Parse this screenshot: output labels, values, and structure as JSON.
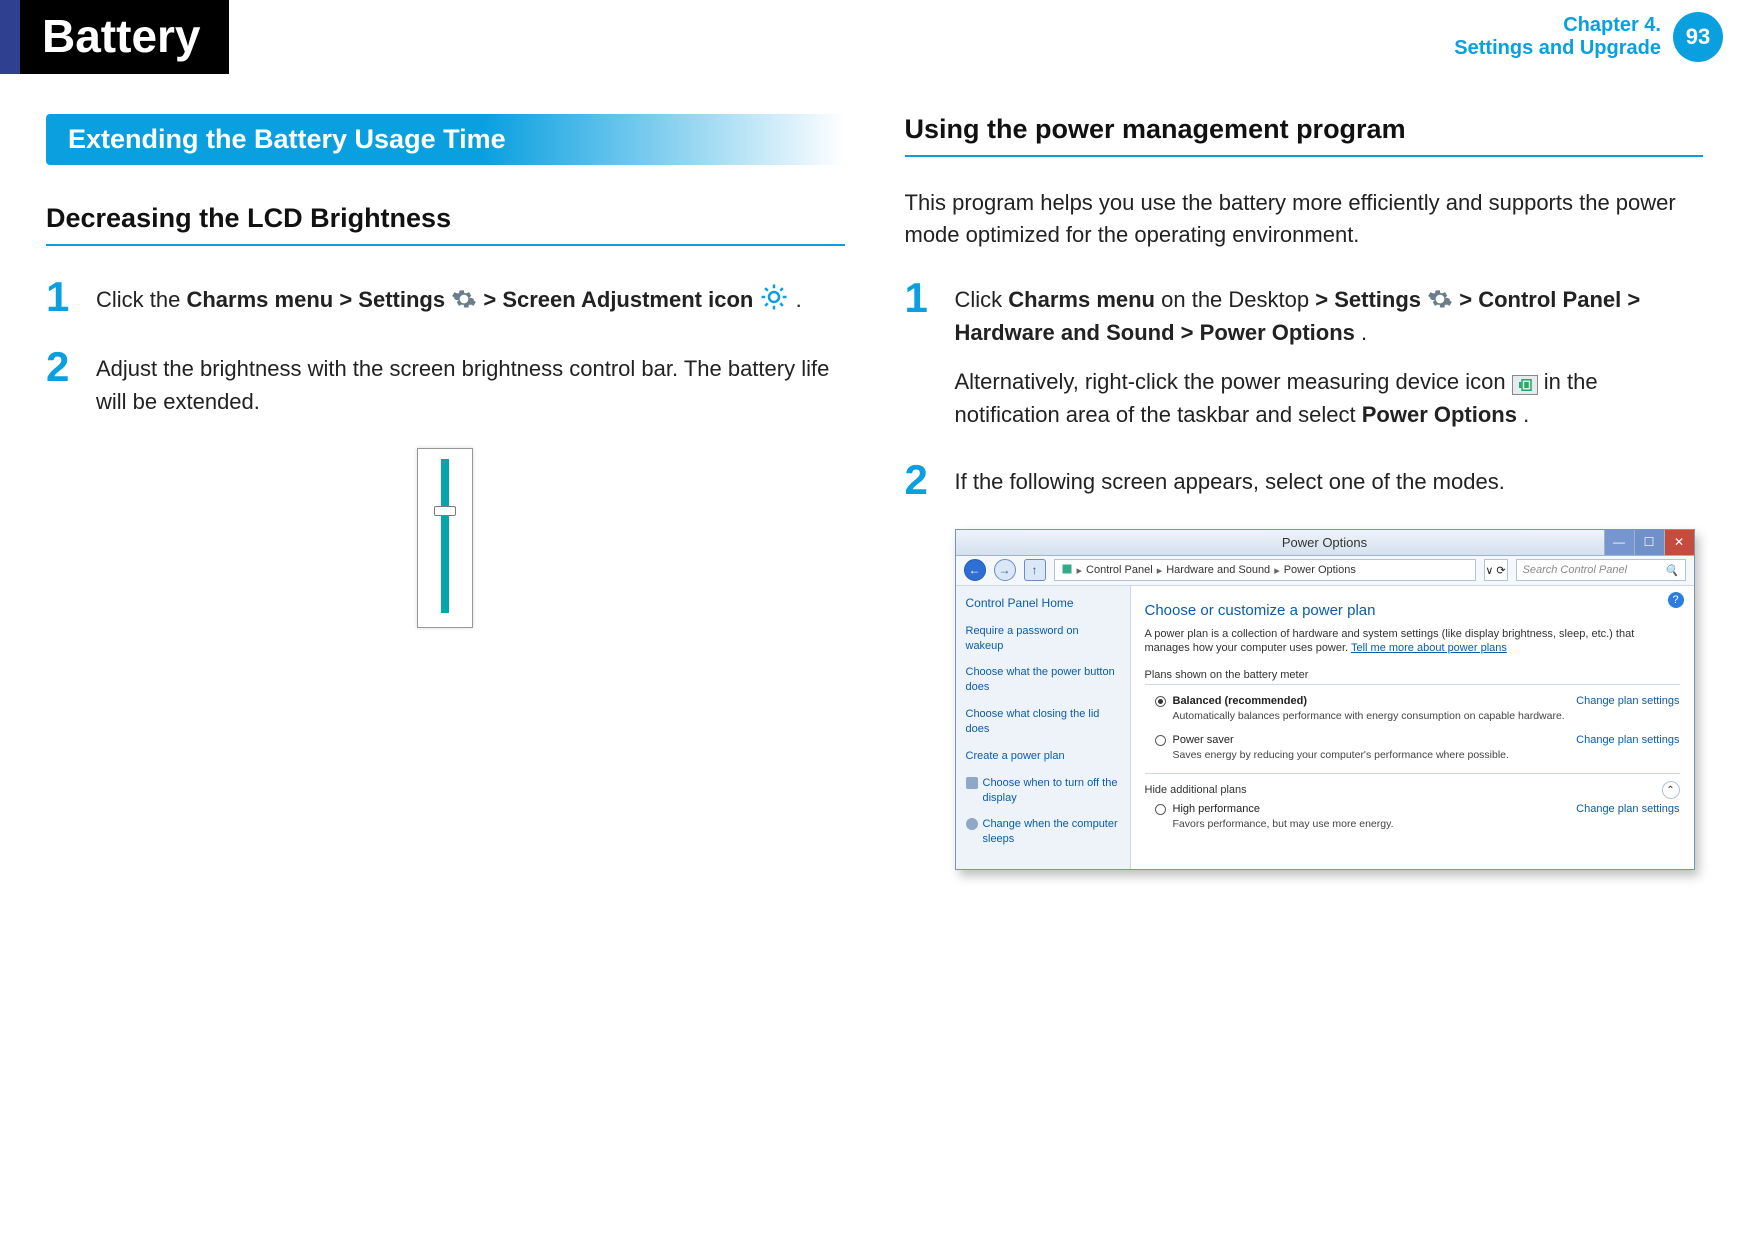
{
  "header": {
    "title": "Battery",
    "chapter_line1": "Chapter 4.",
    "chapter_line2": "Settings and Upgrade",
    "page": "93"
  },
  "left": {
    "banner": "Extending the Battery Usage Time",
    "h2": "Decreasing the LCD Brightness",
    "step1": {
      "pre": "Click the ",
      "b1": "Charms menu",
      "gt1": " > ",
      "b2": "Settings",
      "gt2": " > ",
      "b3": "Screen Adjustment icon",
      "end": " ."
    },
    "step2": "Adjust the brightness with the screen brightness control bar. The battery life will be extended."
  },
  "right": {
    "h2": "Using the power management program",
    "intro": "This program helps you use the battery more efficiently and supports the power mode optimized for the operating environment.",
    "step1": {
      "pre": "Click ",
      "b1": "Charms menu",
      "mid1": " on the Desktop ",
      "gt1": "> ",
      "b2": "Settings",
      "gt2": " > ",
      "b3": "Control Panel",
      "gt3": " > ",
      "b4": "Hardware and Sound",
      "gt4": " > ",
      "b5": "Power Options",
      "end1": ".",
      "alt_pre": "Alternatively, right-click the power measuring device icon ",
      "alt_mid": " in the notification area of the taskbar and select ",
      "b6": "Power Options",
      "end2": "."
    },
    "step2": "If the following screen appears, select one of the modes."
  },
  "po": {
    "title": "Power Options",
    "breadcrumb": {
      "seg1": "Control Panel",
      "seg2": "Hardware and Sound",
      "seg3": "Power Options"
    },
    "search_placeholder": "Search Control Panel",
    "side": {
      "home": "Control Panel Home",
      "l1": "Require a password on wakeup",
      "l2": "Choose what the power button does",
      "l3": "Choose what closing the lid does",
      "l4": "Create a power plan",
      "l5": "Choose when to turn off the display",
      "l6": "Change when the computer sleeps"
    },
    "main": {
      "title": "Choose or customize a power plan",
      "desc1": "A power plan is a collection of hardware and system settings (like display brightness, sleep, etc.) that manages how your computer uses power. ",
      "desc_link": "Tell me more about power plans",
      "sub": "Plans shown on the battery meter",
      "plan1_name": "Balanced (recommended)",
      "plan1_sub": "Automatically balances performance with energy consumption on capable hardware.",
      "plan2_name": "Power saver",
      "plan2_sub": "Saves energy by reducing your computer's performance where possible.",
      "change": "Change plan settings",
      "hide": "Hide additional plans",
      "plan3_name": "High performance",
      "plan3_sub": "Favors performance, but may use more energy."
    }
  }
}
